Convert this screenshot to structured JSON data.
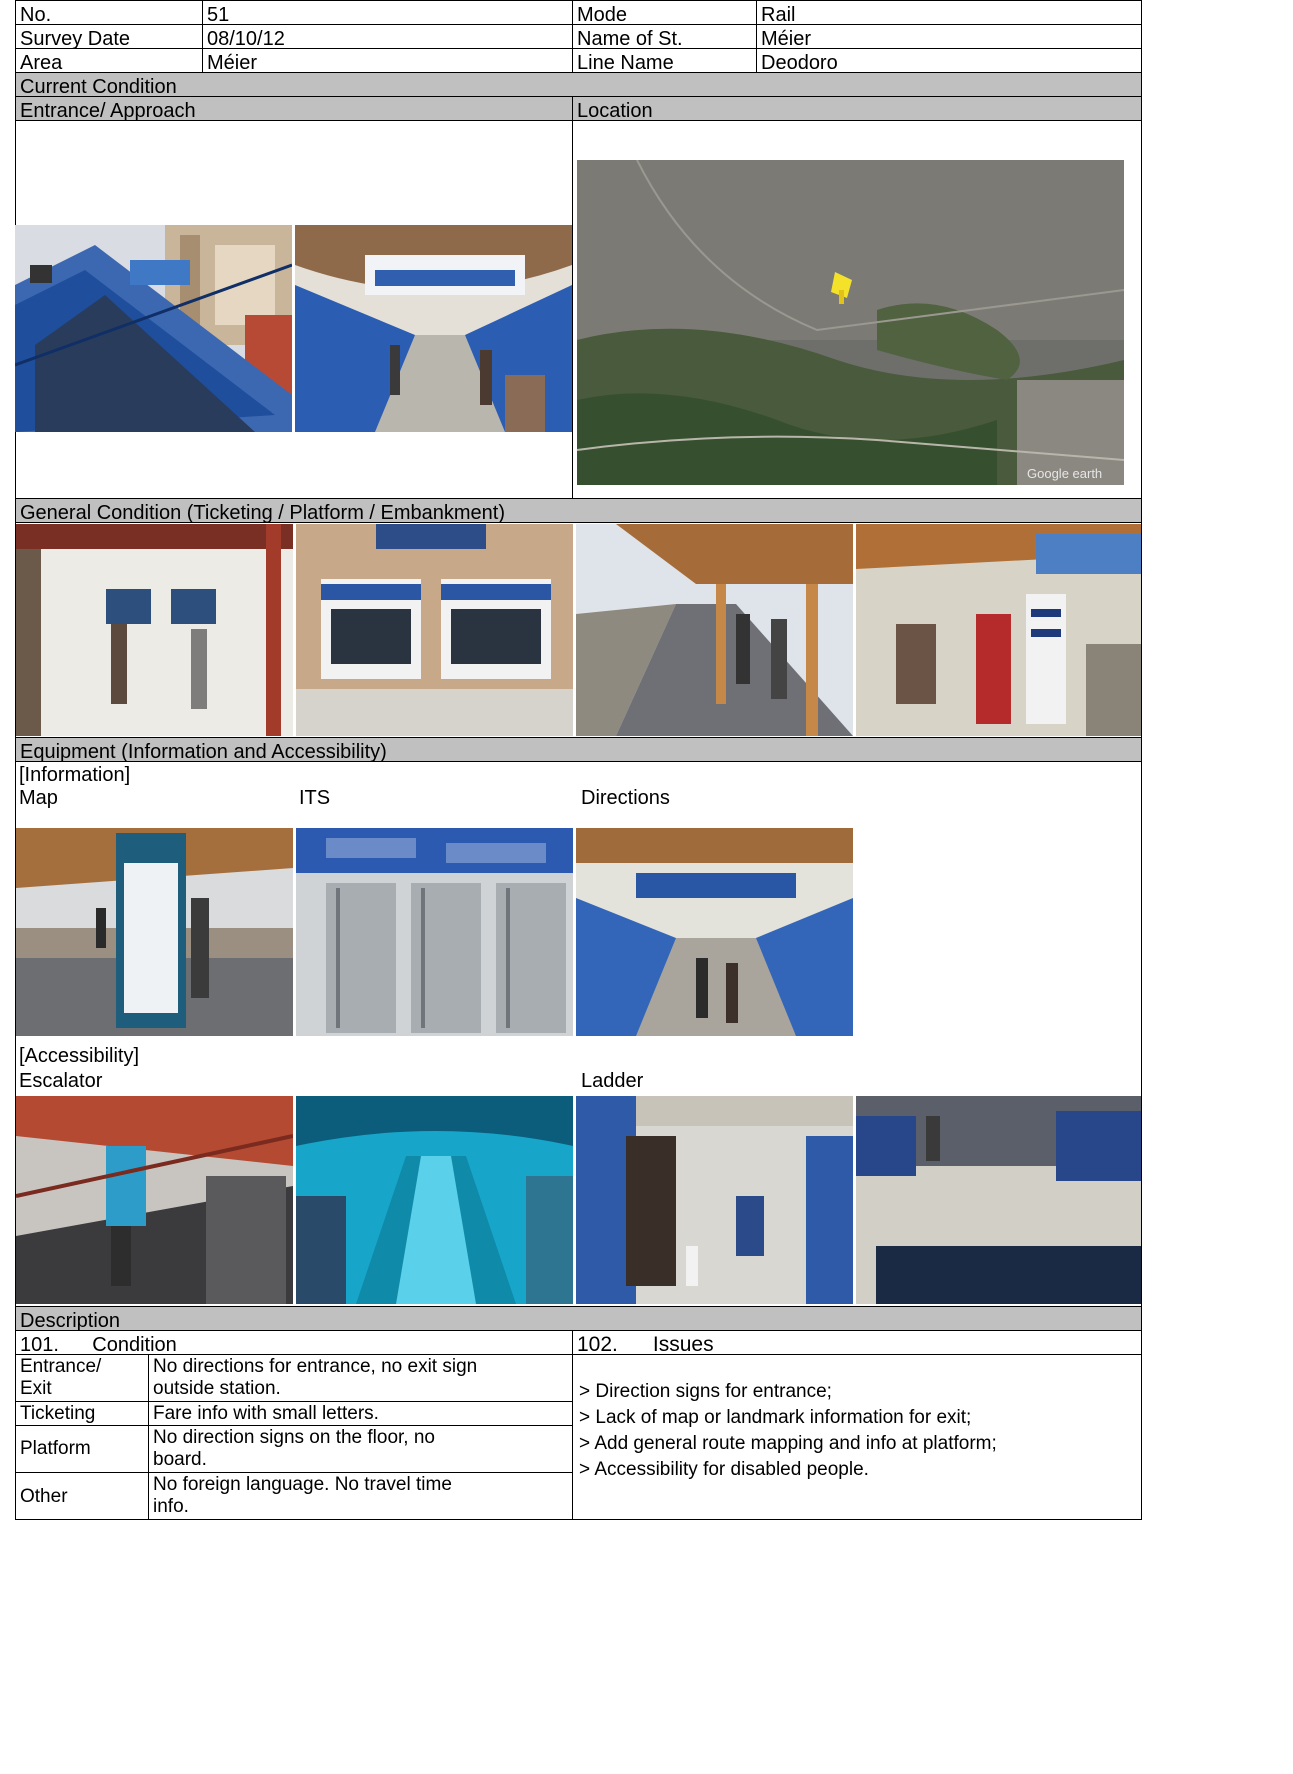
{
  "header": {
    "no_label": "No.",
    "no_value": "51",
    "mode_label": "Mode",
    "mode_value": "Rail",
    "date_label": "Survey Date",
    "date_value": "08/10/12",
    "station_label": "Name of St.",
    "station_value": "Méier",
    "area_label": "Area",
    "area_value": "Méier",
    "line_label": "Line Name",
    "line_value": "Deodoro"
  },
  "sections": {
    "current_condition": "Current Condition",
    "entrance_approach": "Entrance/ Approach",
    "location": "Location",
    "general_condition": "General Condition (Ticketing / Platform / Embankment)",
    "equipment": "Equipment (Information  and Accessibility)",
    "description": "Description"
  },
  "equipment": {
    "information_label": "[Information]",
    "map_label": "Map",
    "its_label": "ITS",
    "directions_label": "Directions",
    "accessibility_label": "[Accessibility]",
    "escalator_label": "Escalator",
    "ladder_label": "Ladder"
  },
  "description": {
    "condition_heading": "101.      Condition",
    "issues_heading": "102.      Issues",
    "rows": [
      {
        "category_line1": "Entrance/",
        "category_line2": "Exit",
        "text_line1": "No directions for entrance, no exit sign",
        "text_line2": "outside station."
      },
      {
        "category_line1": "Ticketing",
        "text_line1": "Fare info with small letters."
      },
      {
        "category_line1": "Platform",
        "text_line1": "No direction signs on the floor, no",
        "text_line2": "board."
      },
      {
        "category_line1": "Other",
        "text_line1": "No foreign language. No travel time",
        "text_line2": "info."
      }
    ],
    "issues": [
      "> Direction signs for entrance;",
      "> Lack of map or landmark information for exit;",
      "> Add general route mapping and info at platform;",
      "> Accessibility for disabled people."
    ]
  },
  "map_watermark": "Google earth",
  "colors": {
    "header_bg": "#c0c0c0",
    "station_blue": "#1f4e9c",
    "roof_orange": "#b9773f"
  }
}
